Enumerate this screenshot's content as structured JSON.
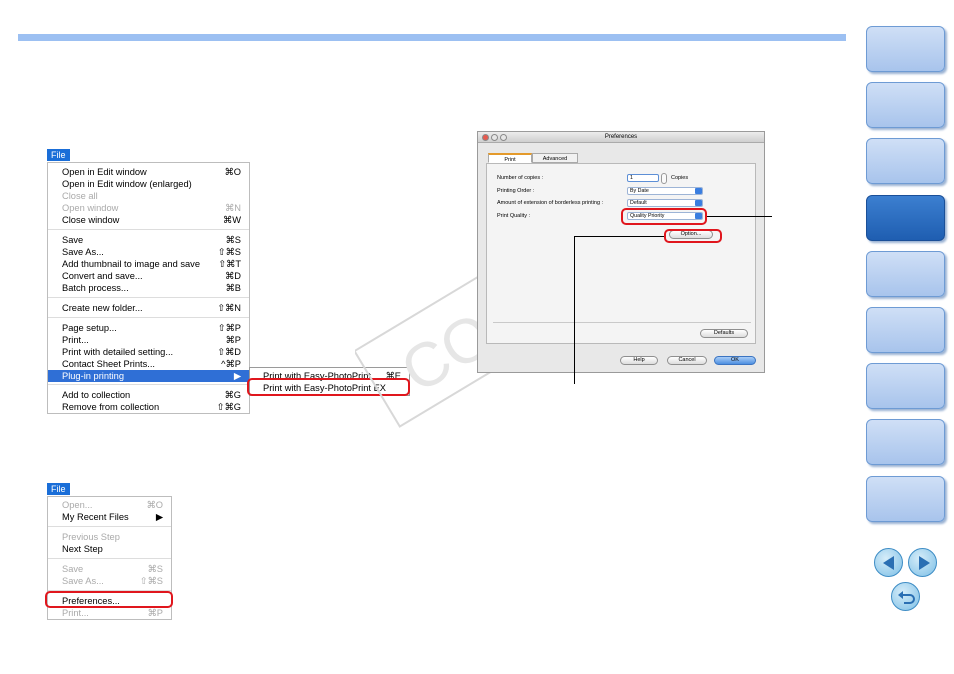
{
  "colors": {
    "accent": "#9cc0f2",
    "menu_highlight": "#2f6fd6",
    "callout": "#e0161d",
    "tab_active": "#2a6bc2"
  },
  "side_tabs": {
    "count": 9,
    "active_index": 3
  },
  "nav_icons": [
    "back-arrow-icon",
    "forward-arrow-icon",
    "return-icon"
  ],
  "menu1": {
    "title": "File",
    "items": [
      {
        "label": "Open in Edit window",
        "shortcut": "⌘O",
        "disabled": false
      },
      {
        "label": "Open in Edit window (enlarged)",
        "shortcut": "",
        "disabled": false
      },
      {
        "label": "Close all",
        "shortcut": "",
        "disabled": true
      },
      {
        "label": "Open window",
        "shortcut": "⌘N",
        "disabled": true
      },
      {
        "label": "Close window",
        "shortcut": "⌘W",
        "disabled": false
      },
      {
        "label": "Save",
        "shortcut": "⌘S",
        "disabled": false
      },
      {
        "label": "Save As...",
        "shortcut": "⇧⌘S",
        "disabled": false
      },
      {
        "label": "Add thumbnail to image and save",
        "shortcut": "⇧⌘T",
        "disabled": false
      },
      {
        "label": "Convert and save...",
        "shortcut": "⌘D",
        "disabled": false
      },
      {
        "label": "Batch process...",
        "shortcut": "⌘B",
        "disabled": false
      },
      {
        "label": "Create new folder...",
        "shortcut": "⇧⌘N",
        "disabled": false
      },
      {
        "label": "Page setup...",
        "shortcut": "⇧⌘P",
        "disabled": false
      },
      {
        "label": "Print...",
        "shortcut": "⌘P",
        "disabled": false
      },
      {
        "label": "Print with detailed setting...",
        "shortcut": "⇧⌘D",
        "disabled": false
      },
      {
        "label": "Contact Sheet Prints...",
        "shortcut": "^⌘P",
        "disabled": false
      },
      {
        "label": "Plug-in printing",
        "shortcut": "▶",
        "disabled": false
      },
      {
        "label": "Add to collection",
        "shortcut": "⌘G",
        "disabled": false
      },
      {
        "label": "Remove from collection",
        "shortcut": "⇧⌘G",
        "disabled": false
      }
    ],
    "submenu": [
      {
        "label": "Print with Easy-PhotoPrint",
        "shortcut": "⌘E"
      },
      {
        "label": "Print with Easy-PhotoPrint EX",
        "shortcut": ""
      }
    ]
  },
  "menu2": {
    "title": "File",
    "items": [
      {
        "label": "Open...",
        "shortcut": "⌘O",
        "disabled": true
      },
      {
        "label": "My Recent Files",
        "shortcut": "▶",
        "disabled": false
      },
      {
        "label": "Previous Step",
        "shortcut": "",
        "disabled": true
      },
      {
        "label": "Next Step",
        "shortcut": "",
        "disabled": false
      },
      {
        "label": "Save",
        "shortcut": "⌘S",
        "disabled": true
      },
      {
        "label": "Save As...",
        "shortcut": "⇧⌘S",
        "disabled": true
      },
      {
        "label": "Preferences...",
        "shortcut": "",
        "disabled": false
      },
      {
        "label": "Print...",
        "shortcut": "⌘P",
        "disabled": true
      }
    ]
  },
  "dialog": {
    "title": "Preferences",
    "tabs": [
      "Print",
      "Advanced"
    ],
    "copies_label": "Number of copies :",
    "copies_value": "1",
    "copies_unit": "Copies",
    "order_label": "Printing Order :",
    "order_value": "By Date",
    "border_label": "Amount of extension of borderless printing :",
    "border_value": "Default",
    "quality_label": "Print Quality :",
    "quality_value": "Quality Priority",
    "option_button": "Option...",
    "defaults_button": "Defaults",
    "help_button": "Help",
    "cancel_button": "Cancel",
    "ok_button": "OK"
  },
  "watermark": "COPY"
}
